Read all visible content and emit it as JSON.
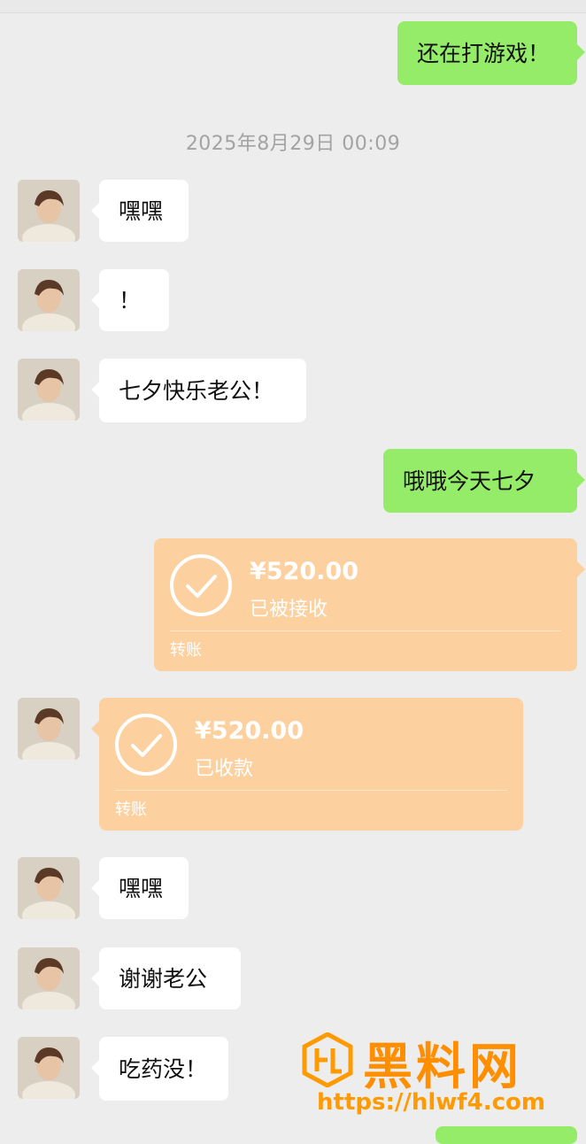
{
  "timestamp": "2025年8月29日 00:09",
  "messages": [
    {
      "side": "out",
      "text": "还在打游戏！"
    },
    {
      "side": "in",
      "text": "嘿嘿"
    },
    {
      "side": "in",
      "text": "！"
    },
    {
      "side": "in",
      "text": "七夕快乐老公！"
    },
    {
      "side": "out",
      "text": "哦哦今天七夕"
    },
    {
      "side": "in",
      "text": "嘿嘿"
    },
    {
      "side": "in",
      "text": "谢谢老公"
    },
    {
      "side": "in",
      "text": "吃药没！"
    }
  ],
  "transfers": [
    {
      "side": "out",
      "amount": "¥520.00",
      "status": "已被接收",
      "label": "转账"
    },
    {
      "side": "in",
      "amount": "¥520.00",
      "status": "已收款",
      "label": "转账"
    }
  ],
  "watermark": {
    "title": "黑料网",
    "url": "https://hlwf4.com"
  },
  "colors": {
    "background": "#ededed",
    "out_bubble": "#95ec69",
    "in_bubble": "#ffffff",
    "transfer": "#fcd19f",
    "watermark": "#ff8f00"
  },
  "icons": {
    "transfer_status": "check-circle-icon",
    "avatar": "contact-avatar"
  }
}
